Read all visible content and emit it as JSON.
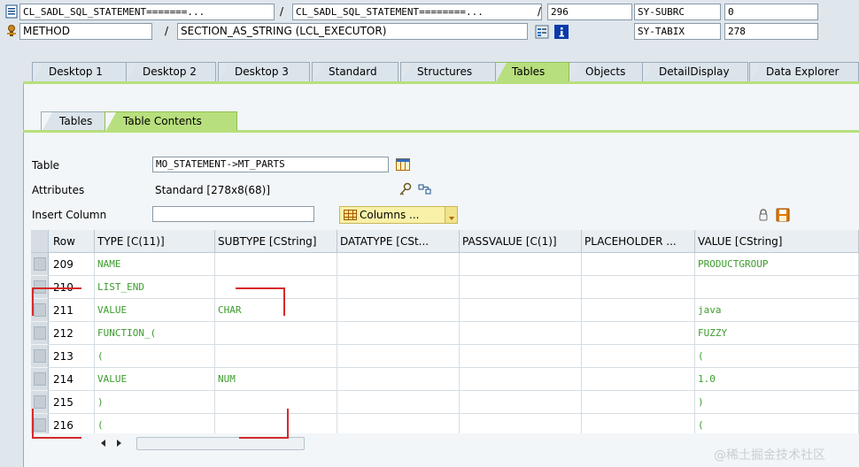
{
  "header": {
    "row1": {
      "field1": "CL_SADL_SQL_STATEMENT=======...",
      "field2": "CL_SADL_SQL_STATEMENT========...",
      "field3": "296",
      "sy_label": "SY-SUBRC",
      "sy_value": "0"
    },
    "row2": {
      "field1": "METHOD",
      "field2": "SECTION_AS_STRING (LCL_EXECUTOR)",
      "sy_label": "SY-TABIX",
      "sy_value": "278"
    },
    "slash": "/"
  },
  "tabs": [
    {
      "label": "Desktop 1"
    },
    {
      "label": "Desktop 2"
    },
    {
      "label": "Desktop 3"
    },
    {
      "label": "Standard"
    },
    {
      "label": "Structures"
    },
    {
      "label": "Tables"
    },
    {
      "label": "Objects"
    },
    {
      "label": "DetailDisplay"
    },
    {
      "label": "Data Explorer"
    }
  ],
  "active_tab": "Tables",
  "subtabs": [
    {
      "label": "Tables"
    },
    {
      "label": "Table Contents"
    }
  ],
  "form": {
    "table_label": "Table",
    "table_value": "MO_STATEMENT->MT_PARTS",
    "attributes_label": "Attributes",
    "attributes_value": "Standard [278x8(68)]",
    "insert_column_label": "Insert Column",
    "insert_column_value": "",
    "columns_button": "Columns ..."
  },
  "grid": {
    "headers": [
      "Row",
      "TYPE [C(11)]",
      "SUBTYPE [CString]",
      "DATATYPE [CSt...",
      "PASSVALUE [C(1)]",
      "PLACEHOLDER ...",
      "VALUE [CString]"
    ],
    "rows": [
      {
        "row": "209",
        "type": "NAME",
        "subtype": "",
        "datatype": "",
        "passvalue": "",
        "placeholder": "",
        "value": "PRODUCTGROUP"
      },
      {
        "row": "210",
        "type": "LIST_END",
        "subtype": "",
        "datatype": "",
        "passvalue": "",
        "placeholder": "",
        "value": ""
      },
      {
        "row": "211",
        "type": "VALUE",
        "subtype": "CHAR",
        "datatype": "",
        "passvalue": "",
        "placeholder": "",
        "value": "java"
      },
      {
        "row": "212",
        "type": "FUNCTION_(",
        "subtype": "",
        "datatype": "",
        "passvalue": "",
        "placeholder": "",
        "value": "FUZZY"
      },
      {
        "row": "213",
        "type": "(",
        "subtype": "",
        "datatype": "",
        "passvalue": "",
        "placeholder": "",
        "value": "("
      },
      {
        "row": "214",
        "type": "VALUE",
        "subtype": "NUM",
        "datatype": "",
        "passvalue": "",
        "placeholder": "",
        "value": "1.0"
      },
      {
        "row": "215",
        "type": ")",
        "subtype": "",
        "datatype": "",
        "passvalue": "",
        "placeholder": "",
        "value": ")"
      },
      {
        "row": "216",
        "type": "(",
        "subtype": "",
        "datatype": "",
        "passvalue": "",
        "placeholder": "",
        "value": "("
      }
    ]
  },
  "watermark": "@稀土掘金技术社区",
  "colors": {
    "active_tab": "#b8df7d",
    "cell_text": "#3d9c2d",
    "annotation": "#d52a2a"
  },
  "icons": [
    "program-icon",
    "method-icon",
    "sap-list-icon",
    "info-icon",
    "table-icon",
    "key-icon",
    "attribute-icon",
    "scroll-left-icon",
    "scroll-right-icon",
    "lock-icon",
    "save-icon",
    "grid-icon",
    "dropdown-icon"
  ]
}
